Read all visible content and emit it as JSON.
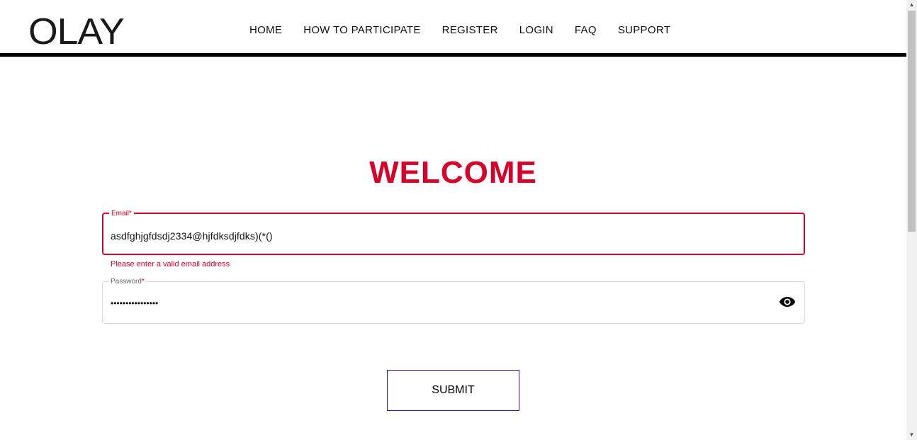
{
  "header": {
    "logo": "OLAY",
    "nav": [
      {
        "label": "HOME"
      },
      {
        "label": "HOW TO PARTICIPATE"
      },
      {
        "label": "REGISTER"
      },
      {
        "label": "LOGIN"
      },
      {
        "label": "FAQ"
      },
      {
        "label": "SUPPORT"
      }
    ]
  },
  "main": {
    "heading": "WELCOME",
    "email": {
      "label": "Email",
      "required_marker": "*",
      "value": "asdfghjgfdsdj2334@hjfdksdjfdks)(*()",
      "error": "Please enter a valid email address"
    },
    "password": {
      "label": "Password",
      "required_marker": "*",
      "value": "••••••••••••••••",
      "toggle_icon": "eye-icon"
    },
    "submit_label": "SUBMIT"
  },
  "colors": {
    "accent": "#d6002a",
    "submit_border": "#3a0ca3",
    "header_rule": "#000000"
  }
}
